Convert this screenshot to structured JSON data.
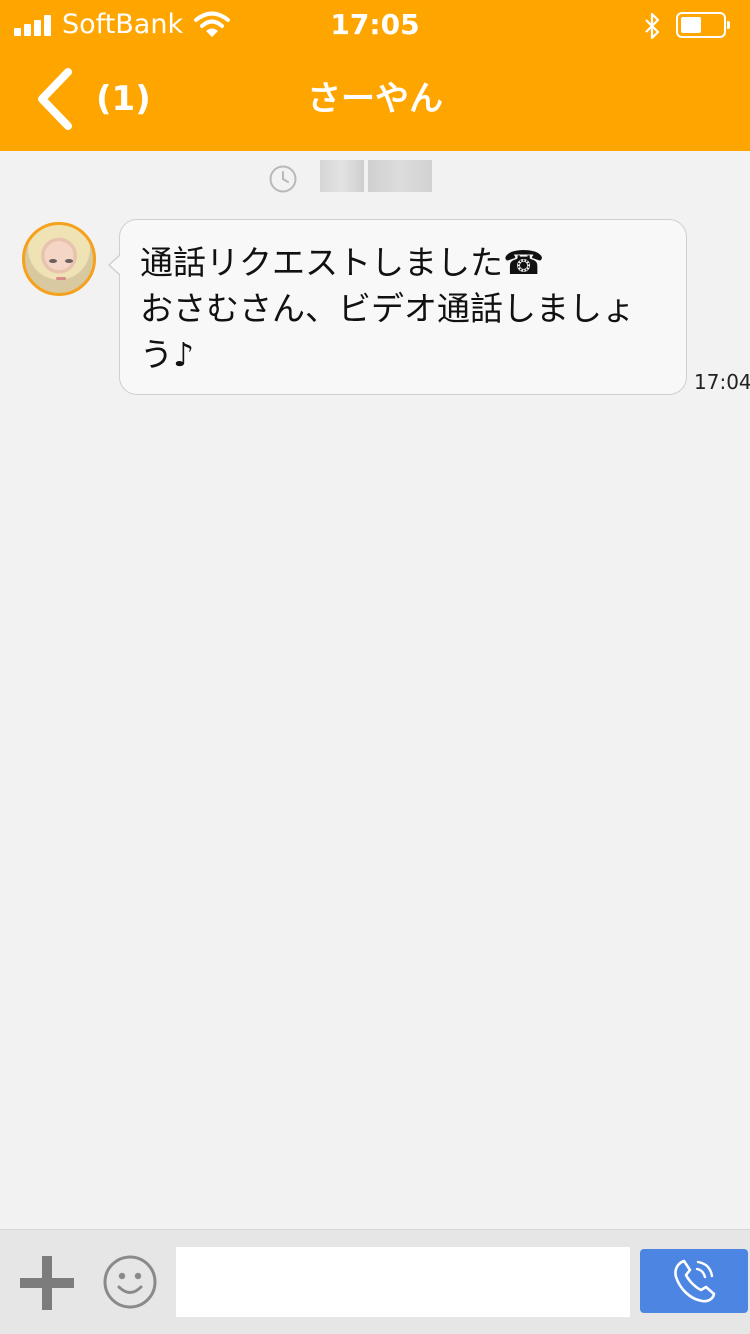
{
  "status_bar": {
    "carrier": "SoftBank",
    "time": "17:05",
    "icons": [
      "signal-icon",
      "wifi-icon",
      "bluetooth-icon",
      "battery-icon"
    ]
  },
  "header": {
    "back_icon": "chevron-left-icon",
    "unread_count": "(1)",
    "title": "さーやん",
    "background_color": "#ffa500"
  },
  "chat": {
    "messages": [
      {
        "sender": "avatar",
        "text": "通話リクエストしました☎\nおさむさん、ビデオ通話しましょう♪",
        "time": "17:04"
      }
    ]
  },
  "composer": {
    "attach_icon": "plus-icon",
    "emoji_icon": "smiley-icon",
    "input_value": "",
    "call_icon": "phone-icon",
    "call_button_color": "#4d86e2"
  }
}
